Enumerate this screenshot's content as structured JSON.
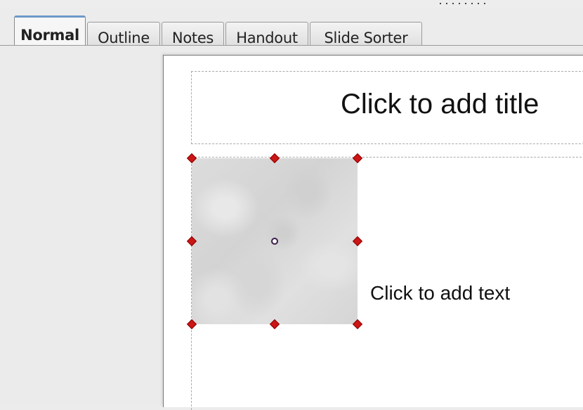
{
  "tabs": [
    {
      "label": "Normal",
      "active": true
    },
    {
      "label": "Outline",
      "active": false
    },
    {
      "label": "Notes",
      "active": false
    },
    {
      "label": "Handout",
      "active": false
    },
    {
      "label": "Slide Sorter",
      "active": false
    }
  ],
  "slide": {
    "title_placeholder": "Click to add title",
    "content_placeholder": "Click to add text",
    "selected_object": "image",
    "image_texture": "marble"
  },
  "colors": {
    "handle": "#cc1515",
    "active_tab_accent": "#6d98c9"
  },
  "icons": {
    "selection_handle": "diamond",
    "rotation_pivot": "circle"
  }
}
